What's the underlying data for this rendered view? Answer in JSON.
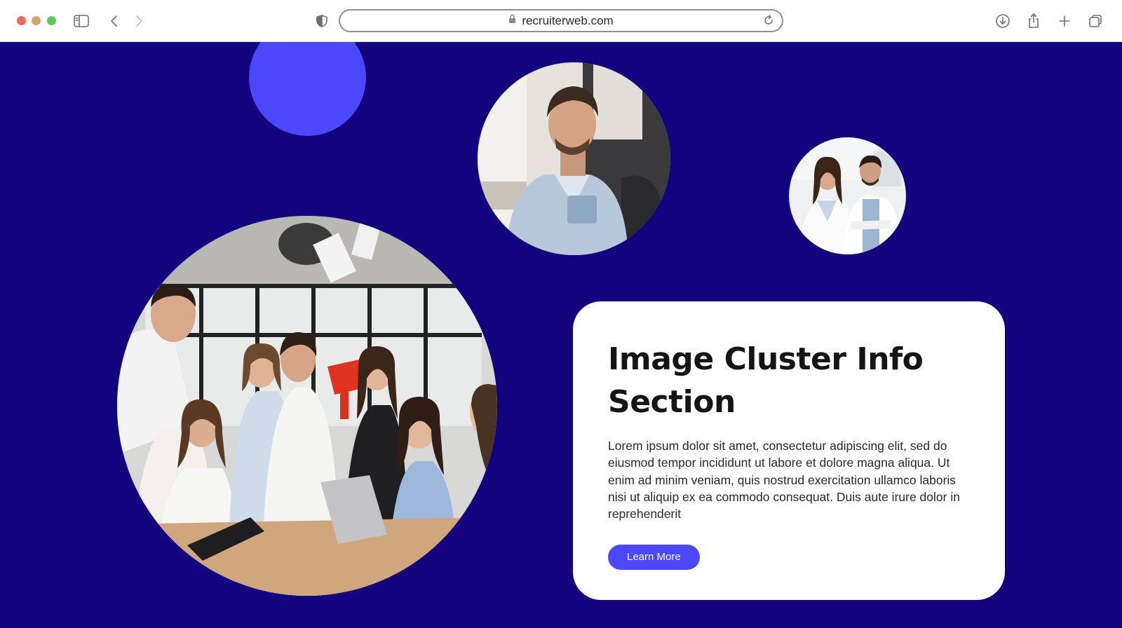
{
  "browser": {
    "url": "recruiterweb.com"
  },
  "section": {
    "title": "Image Cluster Info Section",
    "body": "Lorem ipsum dolor sit amet, consectetur adipiscing elit, sed do eiusmod tempor incididunt ut labore et dolore magna aliqua. Ut enim ad minim veniam, quis nostrud exercitation ullamco laboris nisi ut aliquip ex ea commodo consequat. Duis aute irure dolor in reprehenderit",
    "button_label": "Learn More"
  },
  "colors": {
    "background": "#13037e",
    "accent": "#4b48fb",
    "card": "#ffffff"
  },
  "images": [
    "team-celebration-photo",
    "man-portrait-photo",
    "doctors-photo"
  ]
}
